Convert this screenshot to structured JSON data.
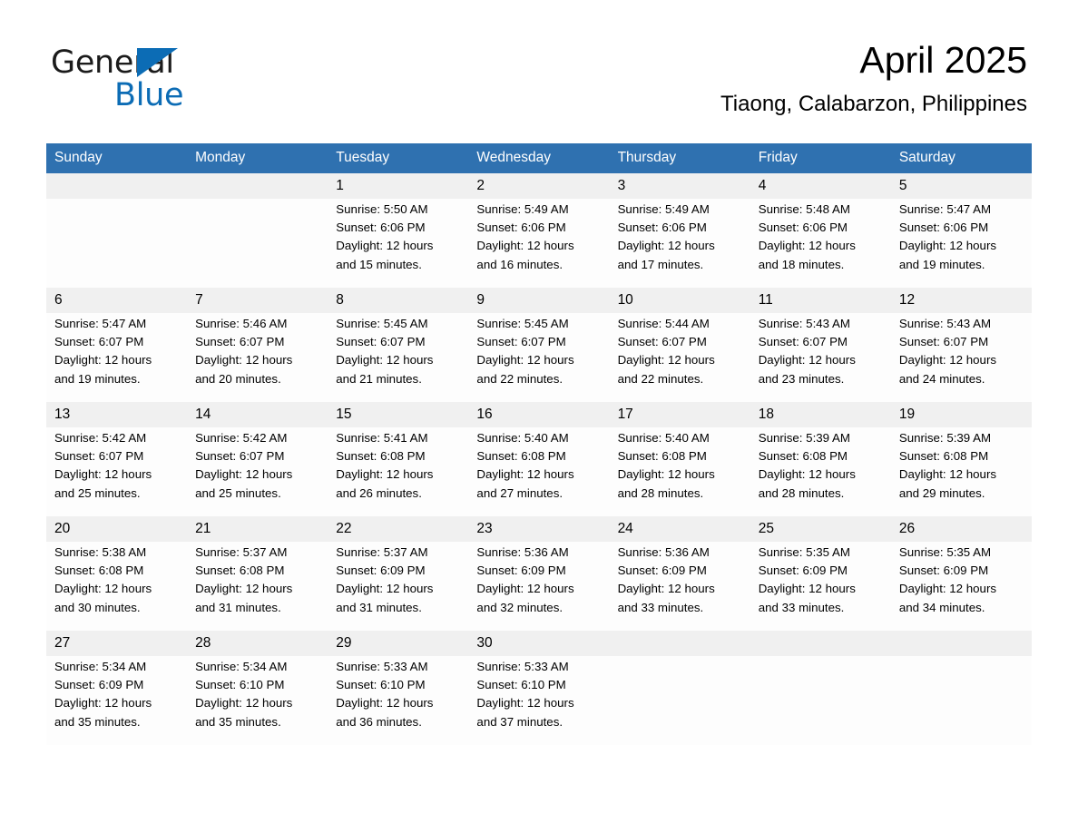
{
  "brand": {
    "name_line1": "General",
    "name_line2": "Blue",
    "triangle_color": "#0c6cb5"
  },
  "header": {
    "title": "April 2025",
    "subtitle": "Tiaong, Calabarzon, Philippines"
  },
  "theme": {
    "header_blue": "#2f71b0",
    "daynum_band": "#f0f0f0",
    "cell_bg": "#fdfdfd",
    "row_divider": "#2f71b0"
  },
  "calendar": {
    "weekday_headers": [
      "Sunday",
      "Monday",
      "Tuesday",
      "Wednesday",
      "Thursday",
      "Friday",
      "Saturday"
    ],
    "weeks": [
      [
        {
          "day": "",
          "lines": []
        },
        {
          "day": "",
          "lines": []
        },
        {
          "day": "1",
          "lines": [
            "Sunrise: 5:50 AM",
            "Sunset: 6:06 PM",
            "Daylight: 12 hours",
            "and 15 minutes."
          ]
        },
        {
          "day": "2",
          "lines": [
            "Sunrise: 5:49 AM",
            "Sunset: 6:06 PM",
            "Daylight: 12 hours",
            "and 16 minutes."
          ]
        },
        {
          "day": "3",
          "lines": [
            "Sunrise: 5:49 AM",
            "Sunset: 6:06 PM",
            "Daylight: 12 hours",
            "and 17 minutes."
          ]
        },
        {
          "day": "4",
          "lines": [
            "Sunrise: 5:48 AM",
            "Sunset: 6:06 PM",
            "Daylight: 12 hours",
            "and 18 minutes."
          ]
        },
        {
          "day": "5",
          "lines": [
            "Sunrise: 5:47 AM",
            "Sunset: 6:06 PM",
            "Daylight: 12 hours",
            "and 19 minutes."
          ]
        }
      ],
      [
        {
          "day": "6",
          "lines": [
            "Sunrise: 5:47 AM",
            "Sunset: 6:07 PM",
            "Daylight: 12 hours",
            "and 19 minutes."
          ]
        },
        {
          "day": "7",
          "lines": [
            "Sunrise: 5:46 AM",
            "Sunset: 6:07 PM",
            "Daylight: 12 hours",
            "and 20 minutes."
          ]
        },
        {
          "day": "8",
          "lines": [
            "Sunrise: 5:45 AM",
            "Sunset: 6:07 PM",
            "Daylight: 12 hours",
            "and 21 minutes."
          ]
        },
        {
          "day": "9",
          "lines": [
            "Sunrise: 5:45 AM",
            "Sunset: 6:07 PM",
            "Daylight: 12 hours",
            "and 22 minutes."
          ]
        },
        {
          "day": "10",
          "lines": [
            "Sunrise: 5:44 AM",
            "Sunset: 6:07 PM",
            "Daylight: 12 hours",
            "and 22 minutes."
          ]
        },
        {
          "day": "11",
          "lines": [
            "Sunrise: 5:43 AM",
            "Sunset: 6:07 PM",
            "Daylight: 12 hours",
            "and 23 minutes."
          ]
        },
        {
          "day": "12",
          "lines": [
            "Sunrise: 5:43 AM",
            "Sunset: 6:07 PM",
            "Daylight: 12 hours",
            "and 24 minutes."
          ]
        }
      ],
      [
        {
          "day": "13",
          "lines": [
            "Sunrise: 5:42 AM",
            "Sunset: 6:07 PM",
            "Daylight: 12 hours",
            "and 25 minutes."
          ]
        },
        {
          "day": "14",
          "lines": [
            "Sunrise: 5:42 AM",
            "Sunset: 6:07 PM",
            "Daylight: 12 hours",
            "and 25 minutes."
          ]
        },
        {
          "day": "15",
          "lines": [
            "Sunrise: 5:41 AM",
            "Sunset: 6:08 PM",
            "Daylight: 12 hours",
            "and 26 minutes."
          ]
        },
        {
          "day": "16",
          "lines": [
            "Sunrise: 5:40 AM",
            "Sunset: 6:08 PM",
            "Daylight: 12 hours",
            "and 27 minutes."
          ]
        },
        {
          "day": "17",
          "lines": [
            "Sunrise: 5:40 AM",
            "Sunset: 6:08 PM",
            "Daylight: 12 hours",
            "and 28 minutes."
          ]
        },
        {
          "day": "18",
          "lines": [
            "Sunrise: 5:39 AM",
            "Sunset: 6:08 PM",
            "Daylight: 12 hours",
            "and 28 minutes."
          ]
        },
        {
          "day": "19",
          "lines": [
            "Sunrise: 5:39 AM",
            "Sunset: 6:08 PM",
            "Daylight: 12 hours",
            "and 29 minutes."
          ]
        }
      ],
      [
        {
          "day": "20",
          "lines": [
            "Sunrise: 5:38 AM",
            "Sunset: 6:08 PM",
            "Daylight: 12 hours",
            "and 30 minutes."
          ]
        },
        {
          "day": "21",
          "lines": [
            "Sunrise: 5:37 AM",
            "Sunset: 6:08 PM",
            "Daylight: 12 hours",
            "and 31 minutes."
          ]
        },
        {
          "day": "22",
          "lines": [
            "Sunrise: 5:37 AM",
            "Sunset: 6:09 PM",
            "Daylight: 12 hours",
            "and 31 minutes."
          ]
        },
        {
          "day": "23",
          "lines": [
            "Sunrise: 5:36 AM",
            "Sunset: 6:09 PM",
            "Daylight: 12 hours",
            "and 32 minutes."
          ]
        },
        {
          "day": "24",
          "lines": [
            "Sunrise: 5:36 AM",
            "Sunset: 6:09 PM",
            "Daylight: 12 hours",
            "and 33 minutes."
          ]
        },
        {
          "day": "25",
          "lines": [
            "Sunrise: 5:35 AM",
            "Sunset: 6:09 PM",
            "Daylight: 12 hours",
            "and 33 minutes."
          ]
        },
        {
          "day": "26",
          "lines": [
            "Sunrise: 5:35 AM",
            "Sunset: 6:09 PM",
            "Daylight: 12 hours",
            "and 34 minutes."
          ]
        }
      ],
      [
        {
          "day": "27",
          "lines": [
            "Sunrise: 5:34 AM",
            "Sunset: 6:09 PM",
            "Daylight: 12 hours",
            "and 35 minutes."
          ]
        },
        {
          "day": "28",
          "lines": [
            "Sunrise: 5:34 AM",
            "Sunset: 6:10 PM",
            "Daylight: 12 hours",
            "and 35 minutes."
          ]
        },
        {
          "day": "29",
          "lines": [
            "Sunrise: 5:33 AM",
            "Sunset: 6:10 PM",
            "Daylight: 12 hours",
            "and 36 minutes."
          ]
        },
        {
          "day": "30",
          "lines": [
            "Sunrise: 5:33 AM",
            "Sunset: 6:10 PM",
            "Daylight: 12 hours",
            "and 37 minutes."
          ]
        },
        {
          "day": "",
          "lines": []
        },
        {
          "day": "",
          "lines": []
        },
        {
          "day": "",
          "lines": []
        }
      ]
    ]
  }
}
